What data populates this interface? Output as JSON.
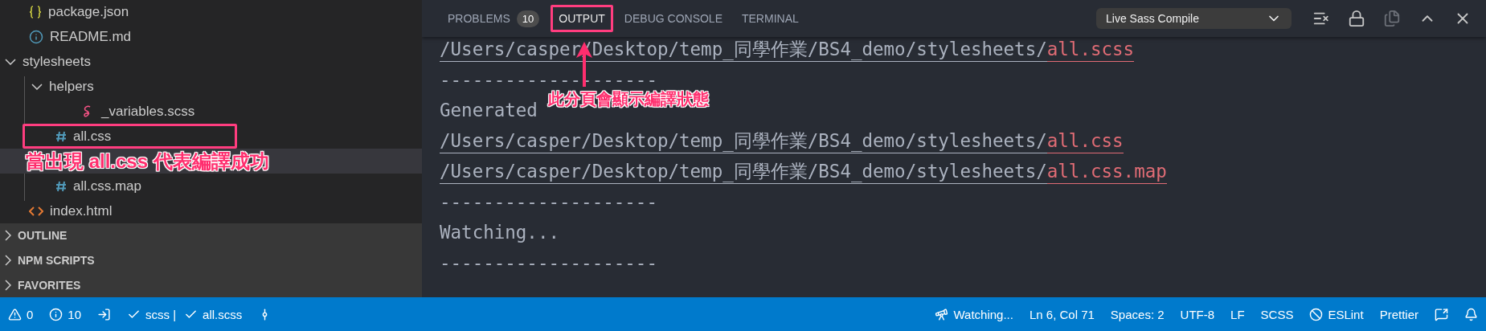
{
  "sidebar": {
    "tree": [
      {
        "kind": "json",
        "label": "package.json"
      },
      {
        "kind": "info",
        "label": "README.md"
      },
      {
        "kind": "folder",
        "label": "stylesheets",
        "expanded": true,
        "children": [
          {
            "kind": "folder",
            "label": "helpers",
            "expanded": true,
            "children": [
              {
                "kind": "sass",
                "label": "_variables.scss"
              }
            ]
          },
          {
            "kind": "css",
            "label": "all.css",
            "callout": true
          },
          {
            "kind": "band",
            "annotation": "當出現 all.css 代表編譯成功"
          },
          {
            "kind": "css",
            "label": "all.css.map"
          }
        ]
      },
      {
        "kind": "html",
        "label": "index.html"
      }
    ],
    "sections": [
      {
        "label": "OUTLINE",
        "expanded": false
      },
      {
        "label": "NPM SCRIPTS",
        "expanded": false
      },
      {
        "label": "FAVORITES",
        "expanded": false
      }
    ]
  },
  "panel": {
    "tabs": [
      {
        "label": "PROBLEMS",
        "badge": "10",
        "selected": false,
        "callout": false
      },
      {
        "label": "OUTPUT",
        "selected": true,
        "callout": true
      },
      {
        "label": "DEBUG CONSOLE",
        "selected": false,
        "callout": false
      },
      {
        "label": "TERMINAL",
        "selected": false,
        "callout": false
      }
    ],
    "channel": "Live Sass Compile",
    "tab_annotation": "此分頁會顯示編譯狀態",
    "output": [
      {
        "kind": "path",
        "path": "/Users/casper/Desktop/temp_同學作業/BS4_demo/stylesheets/",
        "file": "all.scss"
      },
      {
        "kind": "plain",
        "text": "--------------------"
      },
      {
        "kind": "plain",
        "text": "Generated"
      },
      {
        "kind": "path",
        "path": "/Users/casper/Desktop/temp_同學作業/BS4_demo/stylesheets/",
        "file": "all.css"
      },
      {
        "kind": "path",
        "path": "/Users/casper/Desktop/temp_同學作業/BS4_demo/stylesheets/",
        "file": "all.css.map"
      },
      {
        "kind": "plain",
        "text": "--------------------"
      },
      {
        "kind": "plain",
        "text": "Watching..."
      },
      {
        "kind": "plain",
        "text": "--------------------"
      }
    ]
  },
  "status_bar": {
    "left": [
      {
        "kind": "warning",
        "text": "0"
      },
      {
        "kind": "info",
        "text": "10"
      },
      {
        "kind": "door"
      },
      {
        "kind": "check",
        "text": "scss |"
      },
      {
        "kind": "check",
        "text": "all.scss"
      },
      {
        "kind": "commit"
      }
    ],
    "right": [
      {
        "kind": "telescope",
        "text": "Watching..."
      },
      {
        "kind": "text",
        "text": "Ln 6, Col 71"
      },
      {
        "kind": "text",
        "text": "Spaces: 2"
      },
      {
        "kind": "text",
        "text": "UTF-8"
      },
      {
        "kind": "text",
        "text": "LF"
      },
      {
        "kind": "text",
        "text": "SCSS"
      },
      {
        "kind": "slash",
        "text": "ESLint"
      },
      {
        "kind": "text",
        "text": "Prettier"
      },
      {
        "kind": "feedback"
      },
      {
        "kind": "bell"
      }
    ]
  }
}
